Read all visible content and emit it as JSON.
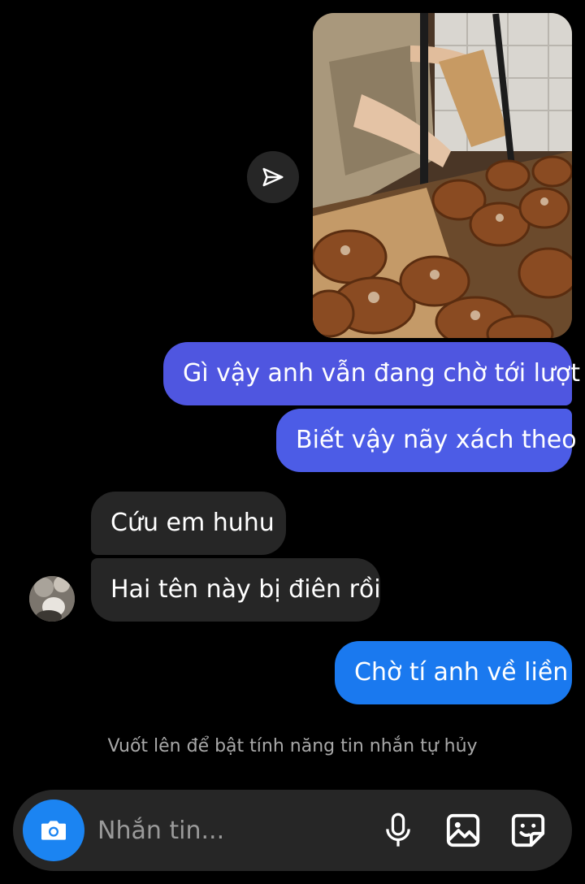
{
  "conversation": {
    "shared_photo_alt": "",
    "share_icon": "paper-plane-icon",
    "messages": [
      {
        "direction": "outgoing",
        "text": "Gì vậy anh vẫn đang chờ tới lượt"
      },
      {
        "direction": "outgoing",
        "text": "Biết vậy nãy xách theo"
      },
      {
        "direction": "incoming",
        "text": "Cứu em huhu"
      },
      {
        "direction": "incoming",
        "text": "Hai tên này bị điên rồi"
      },
      {
        "direction": "outgoing",
        "text": "Chờ tí anh về liền"
      }
    ],
    "hint": "Vuốt lên để bật tính năng tin nhắn tự hủy"
  },
  "composer": {
    "placeholder": "Nhắn tin...",
    "value": "",
    "icons": {
      "camera": "camera-icon",
      "mic": "microphone-icon",
      "gallery": "image-icon",
      "sticker": "sticker-icon"
    }
  },
  "colors": {
    "background": "#000000",
    "outgoing_bubble_gradient_start": "#4f56e0",
    "outgoing_bubble_end": "#1a79ef",
    "incoming_bubble": "#262626",
    "camera_button": "#1b84f2",
    "hint_text": "#a8a8a8"
  }
}
